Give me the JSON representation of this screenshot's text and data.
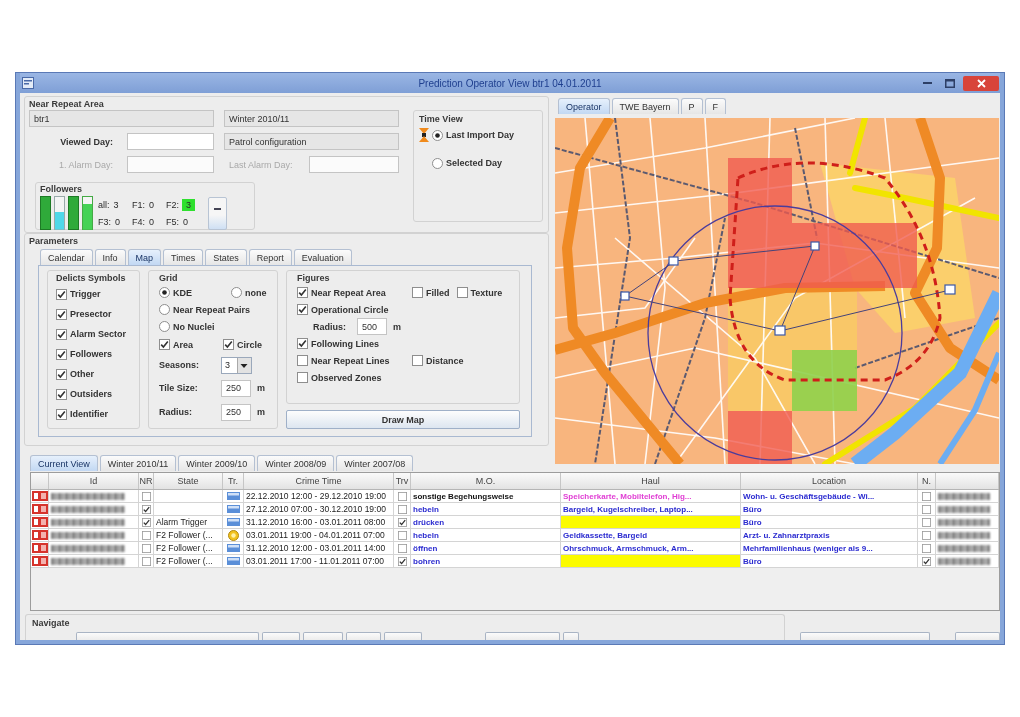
{
  "window": {
    "title": "Prediction Operator View btr1 04.01.2011"
  },
  "near_repeat_area": {
    "title": "Near Repeat Area",
    "area": "btr1",
    "season": "Winter 2010/11",
    "configuration": "Patrol configuration",
    "days": [
      {
        "label": "Viewed Day:",
        "disabled": false
      },
      {
        "label": "1. Alarm Day:",
        "disabled": true
      },
      {
        "label": "Last Alarm Day:",
        "disabled": true
      }
    ],
    "followers": {
      "title": "Followers",
      "counts": [
        {
          "label": "all:",
          "value": "3",
          "highlighted": false
        },
        {
          "label": "F1:",
          "value": "0",
          "highlighted": false
        },
        {
          "label": "F2:",
          "value": "3",
          "highlighted": true
        },
        {
          "label": "F3:",
          "value": "0",
          "highlighted": false
        },
        {
          "label": "F4:",
          "value": "0",
          "highlighted": false
        },
        {
          "label": "F5:",
          "value": "0",
          "highlighted": false
        }
      ]
    }
  },
  "time_view": {
    "title": "Time View",
    "options": [
      {
        "label": "Last Import Day",
        "selected": true
      },
      {
        "label": "Selected Day",
        "selected": false
      }
    ]
  },
  "parameters": {
    "title": "Parameters",
    "tabs": [
      {
        "label": "Calendar",
        "selected": false
      },
      {
        "label": "Info",
        "selected": false
      },
      {
        "label": "Map",
        "selected": true
      },
      {
        "label": "Times",
        "selected": false
      },
      {
        "label": "States",
        "selected": false
      },
      {
        "label": "Report",
        "selected": false
      },
      {
        "label": "Evaluation",
        "selected": false
      }
    ],
    "delicts_symbols": {
      "title": "Delicts Symbols",
      "items": [
        {
          "label": "Trigger",
          "checked": true
        },
        {
          "label": "Presector",
          "checked": true
        },
        {
          "label": "Alarm Sector",
          "checked": true
        },
        {
          "label": "Followers",
          "checked": true
        },
        {
          "label": "Other",
          "checked": true
        },
        {
          "label": "Outsiders",
          "checked": true
        },
        {
          "label": "Identifier",
          "checked": true
        }
      ]
    },
    "grid": {
      "title": "Grid",
      "rows": [
        {
          "kind": "radios",
          "items": [
            {
              "label": "KDE",
              "selected": true
            },
            {
              "label": "none",
              "selected": false
            }
          ]
        },
        {
          "kind": "radios",
          "items": [
            {
              "label": "Near Repeat Pairs",
              "selected": false
            }
          ]
        },
        {
          "kind": "radios",
          "items": [
            {
              "label": "No Nuclei",
              "selected": false
            }
          ]
        },
        {
          "kind": "checks",
          "items": [
            {
              "label": "Area",
              "checked": true
            },
            {
              "label": "Circle",
              "checked": true
            }
          ]
        },
        {
          "kind": "combo",
          "label": "Seasons:",
          "value": "3"
        },
        {
          "kind": "field",
          "label": "Tile Size:",
          "value": "250",
          "unit": "m"
        },
        {
          "kind": "field",
          "label": "Radius:",
          "value": "250",
          "unit": "m"
        }
      ]
    },
    "figures": {
      "title": "Figures",
      "rows": [
        {
          "kind": "checks",
          "items": [
            {
              "label": "Near Repeat Area",
              "checked": true
            },
            {
              "label": "Filled",
              "checked": false
            },
            {
              "label": "Texture",
              "checked": false
            }
          ]
        },
        {
          "kind": "checks",
          "items": [
            {
              "label": "Operational Circle",
              "checked": true
            }
          ]
        },
        {
          "kind": "field",
          "label": "Radius:",
          "value": "500",
          "unit": "m"
        },
        {
          "kind": "checks",
          "items": [
            {
              "label": "Following Lines",
              "checked": true
            }
          ]
        },
        {
          "kind": "checks",
          "items": [
            {
              "label": "Near Repeat Lines",
              "checked": false
            },
            {
              "label": "Distance",
              "checked": false
            }
          ]
        },
        {
          "kind": "checks",
          "items": [
            {
              "label": "Observed Zones",
              "checked": false
            }
          ]
        }
      ]
    },
    "draw_button": "Draw Map"
  },
  "season_tabs": [
    {
      "label": "Current View",
      "selected": true
    },
    {
      "label": "Winter 2010/11",
      "selected": false
    },
    {
      "label": "Winter 2009/10",
      "selected": false
    },
    {
      "label": "Winter 2008/09",
      "selected": false
    },
    {
      "label": "Winter 2007/08",
      "selected": false
    }
  ],
  "map_tabs": [
    {
      "label": "Operator",
      "selected": true
    },
    {
      "label": "TWE Bayern",
      "selected": false
    },
    {
      "label": "P",
      "selected": false
    },
    {
      "label": "F",
      "selected": false
    }
  ],
  "table": {
    "columns": [
      "Id",
      "NR",
      "State",
      "Tr.",
      "Crime Time",
      "Trv",
      "M.O.",
      "Haul",
      "Location",
      "N."
    ],
    "rows": [
      {
        "nr_checked": false,
        "tr": {
          "kind": "card"
        },
        "crime_time": "22.12.2010 12:00 - 29.12.2010 19:00",
        "trv_checked": false,
        "mo": {
          "text": "sonstige Begehungsweise",
          "color": "#111111"
        },
        "haul": {
          "text": "Speicherkarte, Mobiltelefon, Hig...",
          "color": "#e03ed4",
          "highlighted": false
        },
        "location": "Wohn- u. Geschäftsgebäude - Wi...",
        "n_checked": false
      },
      {
        "nr_checked": true,
        "tr": {
          "kind": "card"
        },
        "crime_time": "27.12.2010 07:00 - 30.12.2010 19:00",
        "trv_checked": false,
        "mo": {
          "text": "hebeln",
          "color": "#2b2bd0"
        },
        "haul": {
          "text": "Bargeld, Kugelschreiber, Laptop...",
          "color": "#2b2bd0",
          "highlighted": false
        },
        "location": "Büro",
        "n_checked": false
      },
      {
        "nr_checked": true,
        "state": "Alarm Trigger",
        "tr": {
          "kind": "card"
        },
        "crime_time": "31.12.2010 16:00 - 03.01.2011 08:00",
        "trv_checked": true,
        "mo": {
          "text": "drücken",
          "color": "#2b2bd0"
        },
        "haul": {
          "highlighted": true
        },
        "location": "Büro",
        "n_checked": false
      },
      {
        "nr_checked": false,
        "state": "F2 Follower (...",
        "tr": {
          "kind": "circle"
        },
        "crime_time": "03.01.2011 19:00 - 04.01.2011 07:00",
        "trv_checked": false,
        "mo": {
          "text": "hebeln",
          "color": "#2b2bd0"
        },
        "haul": {
          "text": "Geldkassette, Bargeld",
          "color": "#2b2bd0",
          "highlighted": false
        },
        "location": "Arzt- u. Zahnarztpraxis",
        "n_checked": false
      },
      {
        "nr_checked": false,
        "state": "F2 Follower (...",
        "tr": {
          "kind": "card"
        },
        "crime_time": "31.12.2010 12:00 - 03.01.2011 14:00",
        "trv_checked": false,
        "mo": {
          "text": "öffnen",
          "color": "#2b2bd0"
        },
        "haul": {
          "text": "Ohrschmuck, Armschmuck, Arm...",
          "color": "#2b2bd0",
          "highlighted": false
        },
        "location": "Mehrfamilienhaus (weniger als 9...",
        "n_checked": false
      },
      {
        "nr_checked": false,
        "state": "F2 Follower (...",
        "tr": {
          "kind": "card"
        },
        "crime_time": "03.01.2011 17:00 - 11.01.2011 07:00",
        "trv_checked": true,
        "mo": {
          "text": "bohren",
          "color": "#2b2bd0"
        },
        "haul": {
          "highlighted": true
        },
        "location": "Büro",
        "n_checked": true
      }
    ]
  },
  "navigate": {
    "title": "Navigate"
  }
}
